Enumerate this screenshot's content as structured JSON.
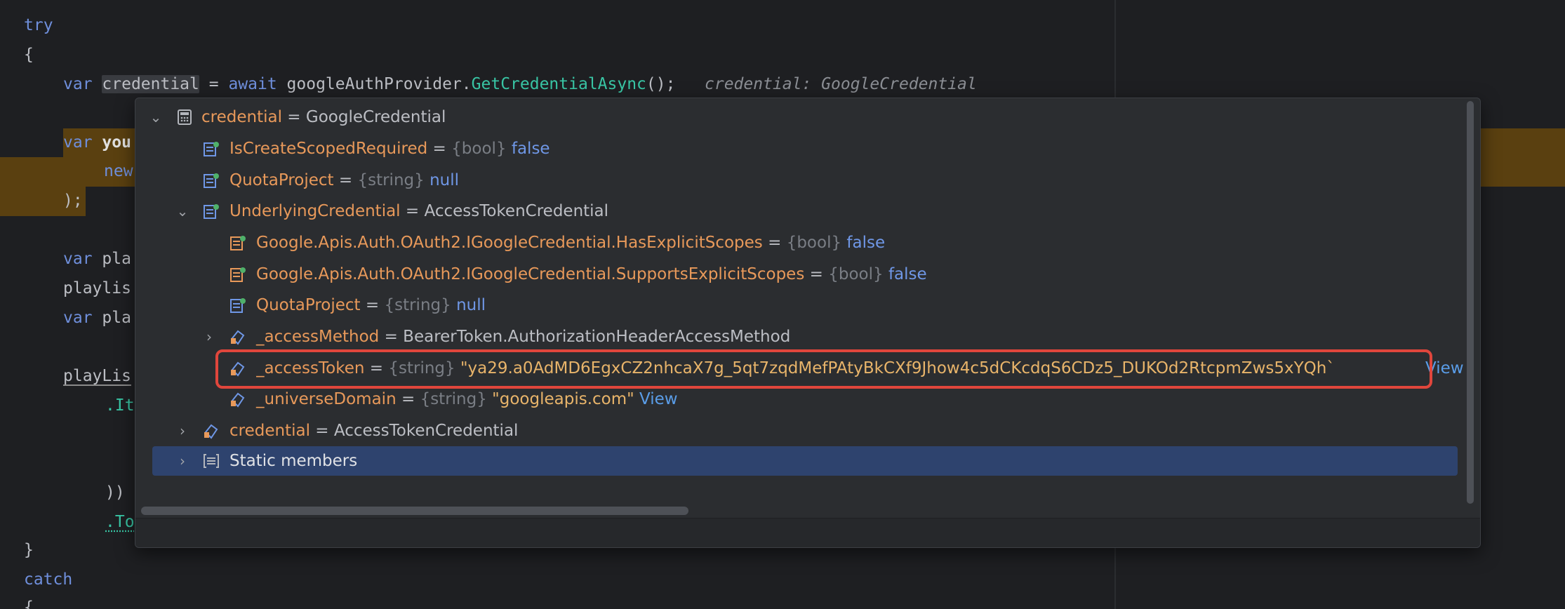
{
  "code": {
    "try_kw": "try",
    "brace_open": "{",
    "line_var": "var",
    "line_credential": "credential",
    "line_assign": " = ",
    "line_await": "await",
    "line_provider": "googleAuthProvider",
    "line_method": "GetCredentialAsync",
    "line_call_end": "();",
    "inline_hint": "credential: GoogleCredential",
    "hl_var": "var",
    "hl_you": "you",
    "hl_new": "new",
    "hl_close": ");",
    "var_pla_1": "var",
    "pla_1": "pla",
    "playlis": "playlis",
    "var_pla_2": "var",
    "pla_2": "pla",
    "playlis_u": "playLis",
    "dot_it": ".It",
    "close_paren": "))",
    "dot_to": ".To",
    "brace_close": "}",
    "catch_kw": "catch",
    "brace_open2": "{"
  },
  "debug_tree": {
    "root": {
      "name": "credential",
      "value": "GoogleCredential"
    },
    "rows": [
      {
        "name": "IsCreateScopedRequired",
        "type": "{bool}",
        "value": "false"
      },
      {
        "name": "QuotaProject",
        "type": "{string}",
        "value": "null"
      },
      {
        "name": "UnderlyingCredential",
        "value": "AccessTokenCredential"
      },
      {
        "name": "Google.Apis.Auth.OAuth2.IGoogleCredential.HasExplicitScopes",
        "type": "{bool}",
        "value": "false"
      },
      {
        "name": "Google.Apis.Auth.OAuth2.IGoogleCredential.SupportsExplicitScopes",
        "type": "{bool}",
        "value": "false"
      },
      {
        "name": "QuotaProject",
        "type": "{string}",
        "value": "null"
      },
      {
        "name": "_accessMethod",
        "value": "BearerToken.AuthorizationHeaderAccessMethod"
      },
      {
        "name": "_accessToken",
        "type": "{string}",
        "value": "\"ya29.a0AdMD6EgxCZ2nhcaX7g_5qt7zqdMefPAtyBkCXf9Jhow4c5dCKcdqS6CDz5_DUKOd2RtcpmZws5xYQh`",
        "link": "View"
      },
      {
        "name": "_universeDomain",
        "type": "{string}",
        "value": "\"googleapis.com\"",
        "link": "View"
      },
      {
        "name": "credential",
        "value": "AccessTokenCredential"
      },
      {
        "name": "Static members"
      }
    ],
    "eq": "="
  },
  "colors": {
    "background": "#1e1f22",
    "popup": "#2b2d30",
    "highlight_box": "#e0463c",
    "selection": "#2e436e",
    "name": "#e8995a",
    "keyword": "#6f97e6"
  },
  "icons": {
    "expand": "chevron-down-icon",
    "collapse": "chevron-right-icon",
    "object": "calculator-object-icon",
    "property": "property-icon",
    "field": "field-icon",
    "static": "static-members-icon"
  }
}
